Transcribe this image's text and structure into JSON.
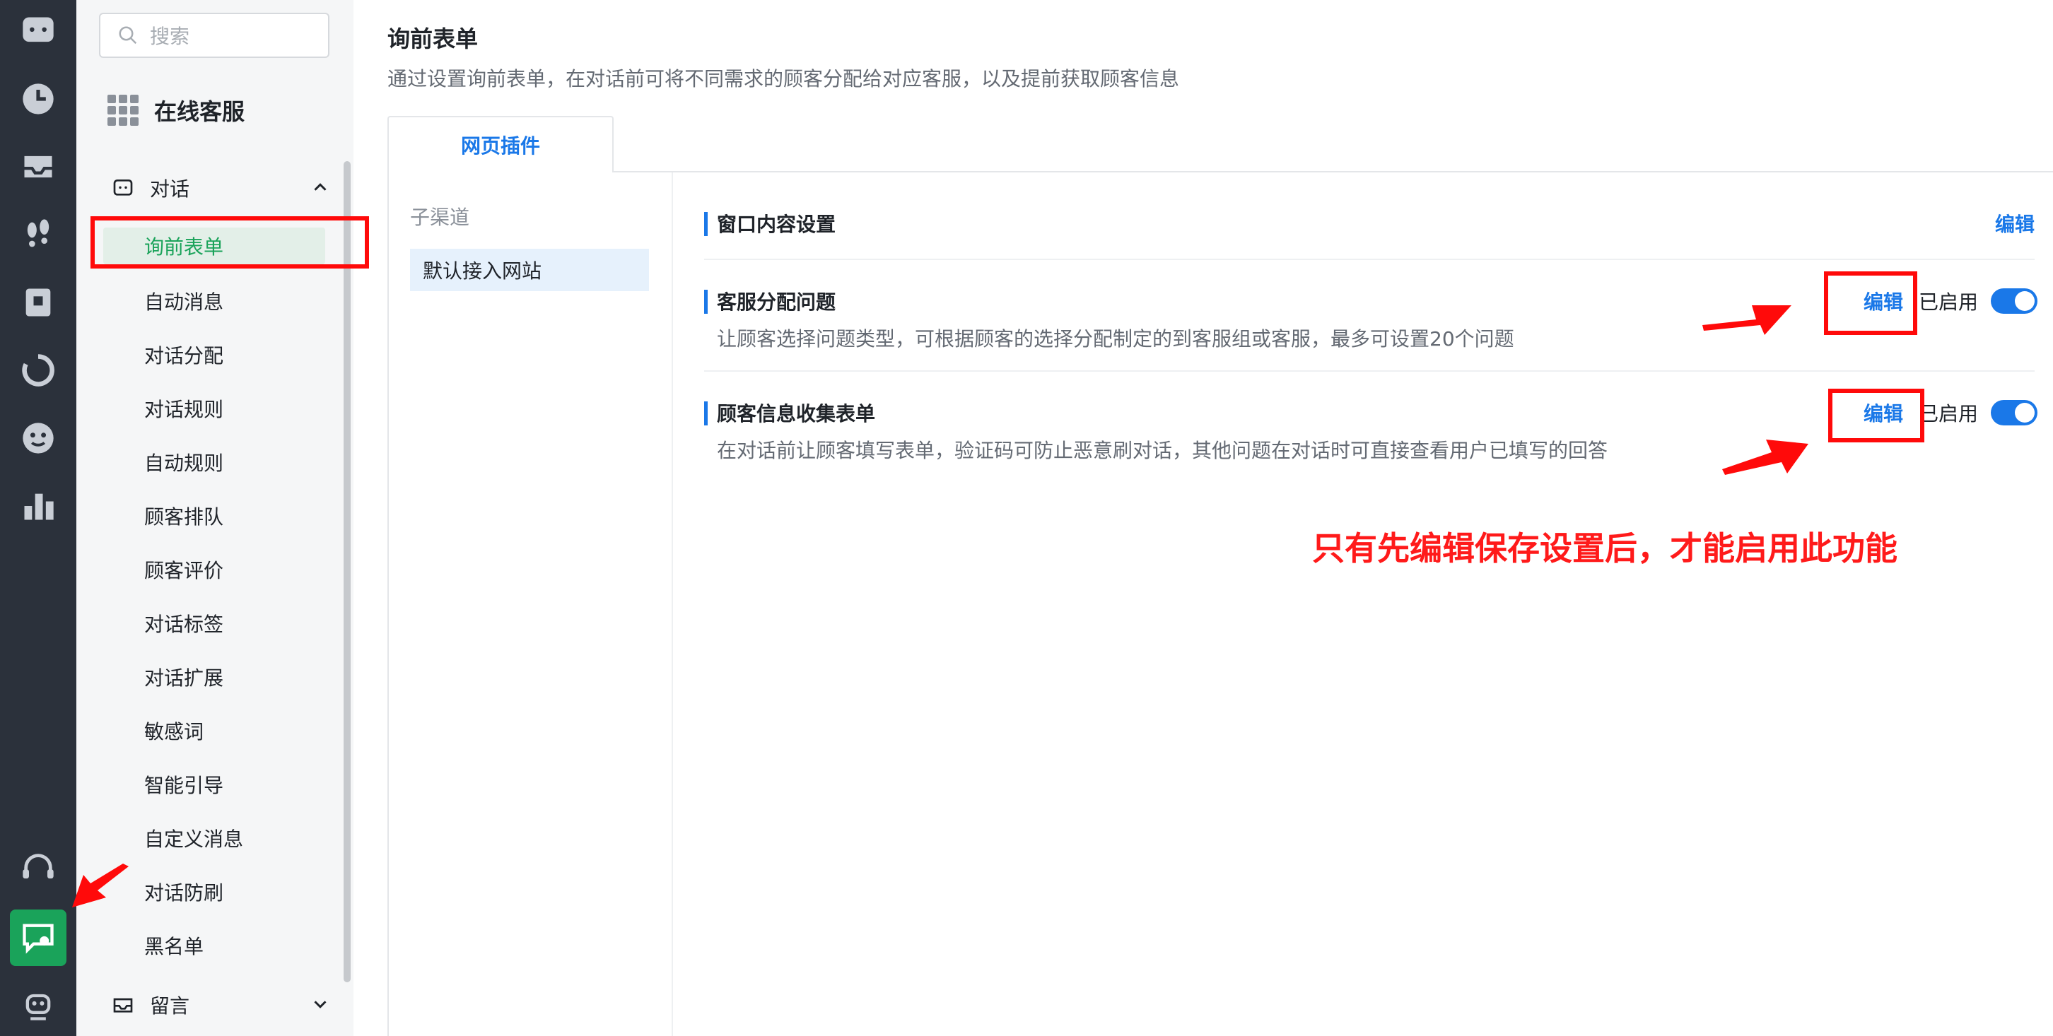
{
  "rail": {
    "icons": [
      "chat-bubble-icon",
      "clock-icon",
      "inbox-icon",
      "footprints-icon",
      "bookmark-icon",
      "refresh-icon",
      "face-icon",
      "bar-chart-icon",
      "headset-icon",
      "chat-settings-icon",
      "robot-icon"
    ]
  },
  "sidebar": {
    "search_placeholder": "搜索",
    "app_title": "在线客服",
    "group_conversation": "对话",
    "items": [
      "询前表单",
      "自动消息",
      "对话分配",
      "对话规则",
      "自动规则",
      "顾客排队",
      "顾客评价",
      "对话标签",
      "对话扩展",
      "敏感词",
      "智能引导",
      "自定义消息",
      "对话防刷",
      "黑名单"
    ],
    "group_message": "留言"
  },
  "main": {
    "title": "询前表单",
    "description": "通过设置询前表单，在对话前可将不同需求的顾客分配给对应客服，以及提前获取顾客信息",
    "tab": "网页插件",
    "sub_channel_header": "子渠道",
    "sub_channel_item": "默认接入网站",
    "sections": [
      {
        "title": "窗口内容设置",
        "description": "",
        "edit": "编辑"
      },
      {
        "title": "客服分配问题",
        "description": "让顾客选择问题类型，可根据顾客的选择分配制定的到客服组或客服，最多可设置20个问题",
        "edit": "编辑",
        "status": "已启用",
        "enabled": true
      },
      {
        "title": "顾客信息收集表单",
        "description": "在对话前让顾客填写表单，验证码可防止恶意刷对话，其他问题在对话时可直接查看用户已填写的回答",
        "edit": "编辑",
        "status": "已启用",
        "enabled": true
      }
    ]
  },
  "annotation": {
    "text": "只有先编辑保存设置后，才能启用此功能",
    "color": "#ff0a0a"
  },
  "colors": {
    "accent_blue": "#1a78e8",
    "accent_green": "#1aa35a",
    "rail_bg": "#2b313b"
  }
}
